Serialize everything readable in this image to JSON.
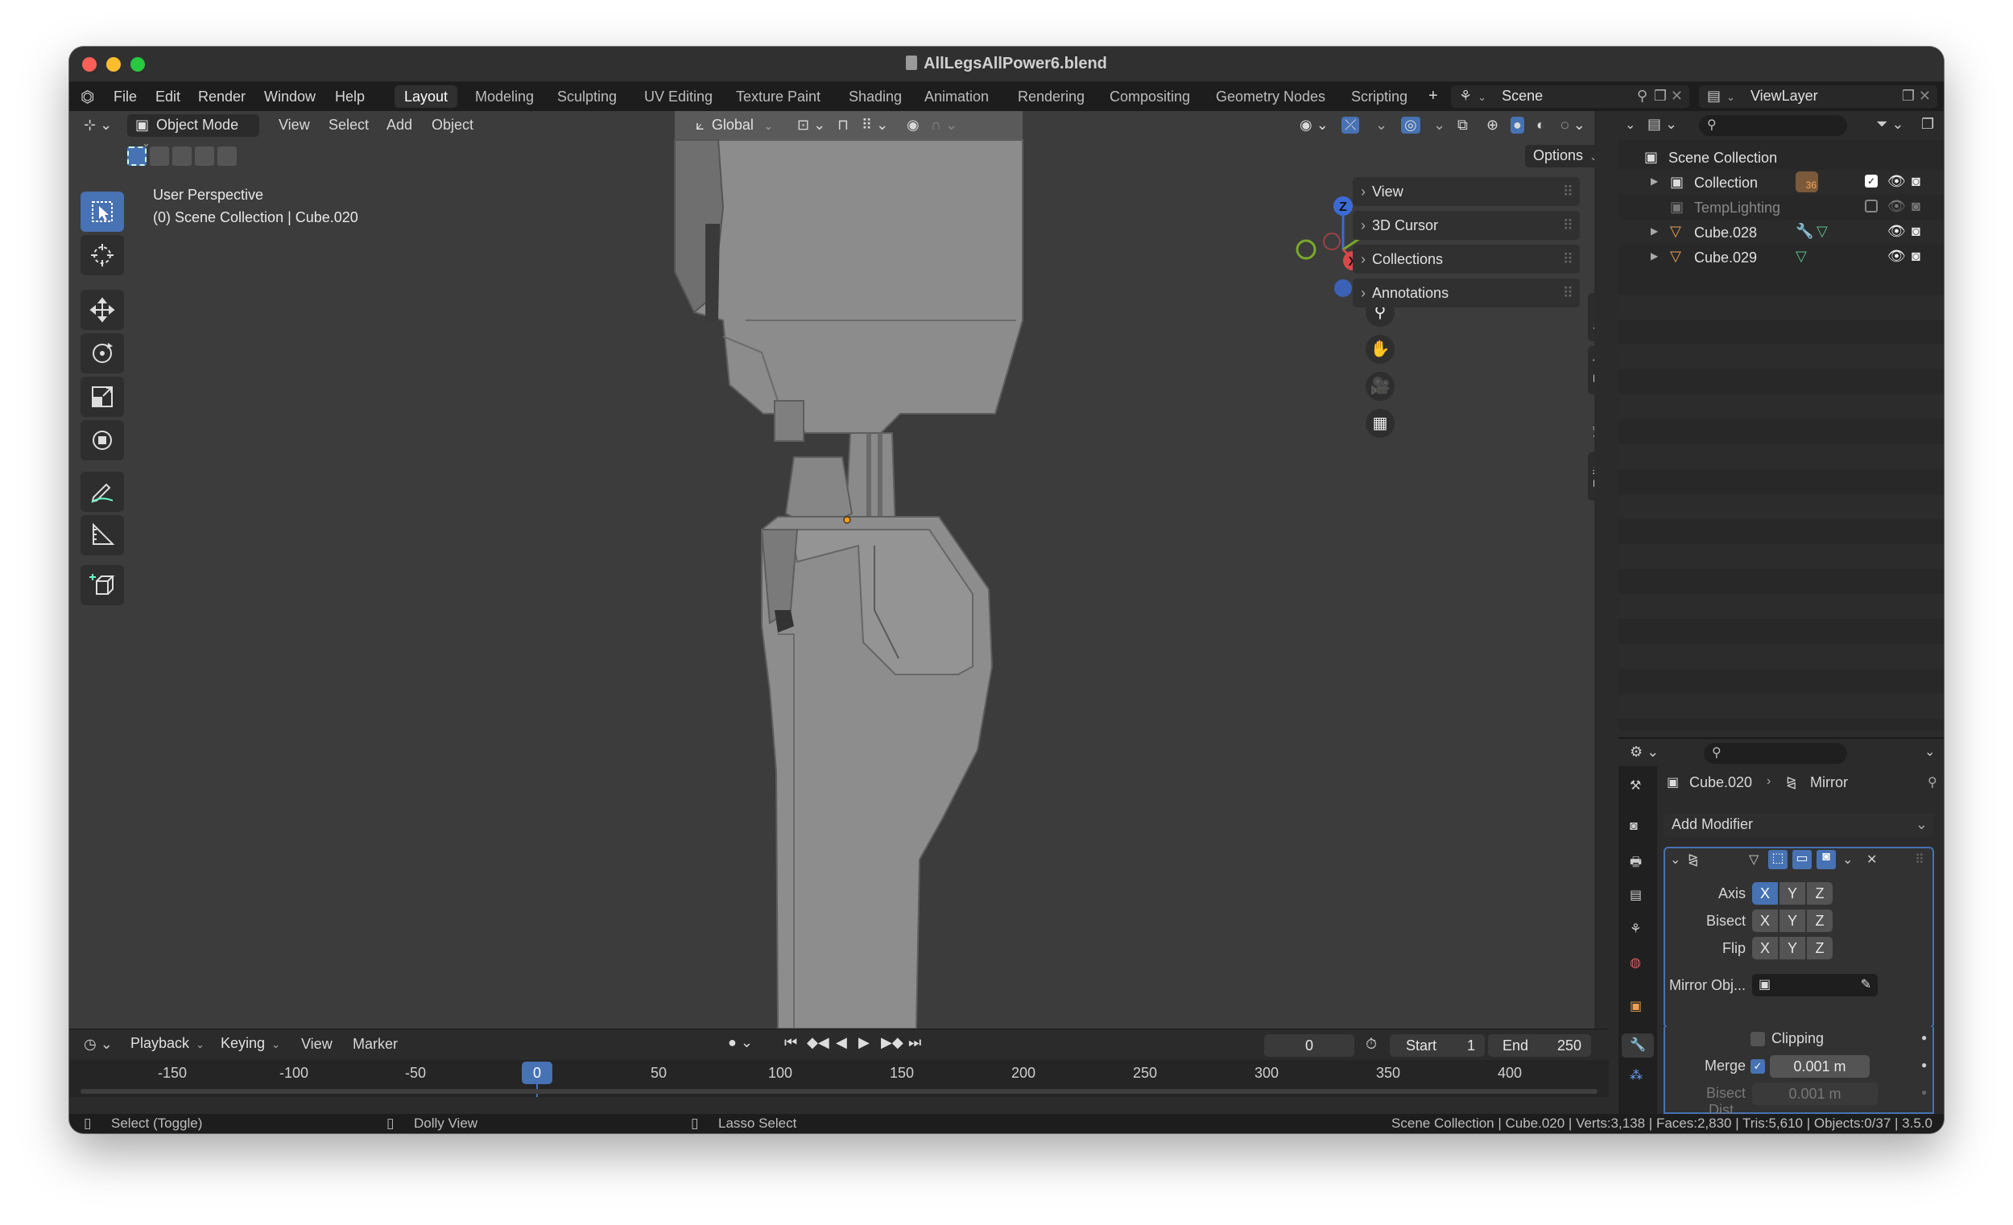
{
  "window": {
    "title": "AllLegsAllPower6.blend"
  },
  "menu": {
    "items": [
      "File",
      "Edit",
      "Render",
      "Window",
      "Help"
    ]
  },
  "workspaces": [
    "Layout",
    "Modeling",
    "Sculpting",
    "UV Editing",
    "Texture Paint",
    "Shading",
    "Animation",
    "Rendering",
    "Compositing",
    "Geometry Nodes",
    "Scripting"
  ],
  "top_right": {
    "scene": "Scene",
    "view_layer": "ViewLayer"
  },
  "viewport": {
    "mode": "Object Mode",
    "header_menus": [
      "View",
      "Select",
      "Add",
      "Object"
    ],
    "transform_orientation": "Global",
    "options_label": "Options",
    "overlay_line1": "User Perspective",
    "overlay_line2": "(0) Scene Collection | Cube.020",
    "npanel_sections": [
      "View",
      "3D Cursor",
      "Collections",
      "Annotations"
    ],
    "npanel_tabs": [
      "Item",
      "Tool",
      "View",
      "Edit"
    ],
    "gizmo_axes": [
      "Z",
      "X",
      "Y"
    ]
  },
  "outliner": {
    "root": "Scene Collection",
    "rows": [
      {
        "name": "Collection",
        "badge": "36"
      },
      {
        "name": "TempLighting"
      },
      {
        "name": "Cube.028"
      },
      {
        "name": "Cube.029"
      }
    ]
  },
  "properties": {
    "object": "Cube.020",
    "modifier": "Mirror",
    "add_modifier": "Add Modifier",
    "axis_label": "Axis",
    "bisect_label": "Bisect",
    "flip_label": "Flip",
    "axes": [
      "X",
      "Y",
      "Z"
    ],
    "mirror_object_label": "Mirror Obj...",
    "clipping_label": "Clipping",
    "merge_label": "Merge",
    "merge_value": "0.001 m",
    "bisect_distance_label": "Bisect Dist...",
    "bisect_distance_value": "0.001 m"
  },
  "timeline": {
    "menus": [
      "Playback",
      "Keying",
      "View",
      "Marker"
    ],
    "current_frame": "0",
    "start_label": "Start",
    "start_value": "1",
    "end_label": "End",
    "end_value": "250",
    "ruler": [
      "-150",
      "-100",
      "-50",
      "0",
      "50",
      "100",
      "150",
      "200",
      "250",
      "300",
      "350",
      "400"
    ],
    "playhead": "0"
  },
  "status": {
    "hint1": "Select (Toggle)",
    "hint2": "Dolly View",
    "hint3": "Lasso Select",
    "stats": "Scene Collection | Cube.020 | Verts:3,138 | Faces:2,830 | Tris:5,610 | Objects:0/37 | 3.5.0"
  },
  "colors": {
    "accent": "#4772b3",
    "viewport_bg": "#3c3c3c",
    "mesh": "#8c8c8c"
  }
}
